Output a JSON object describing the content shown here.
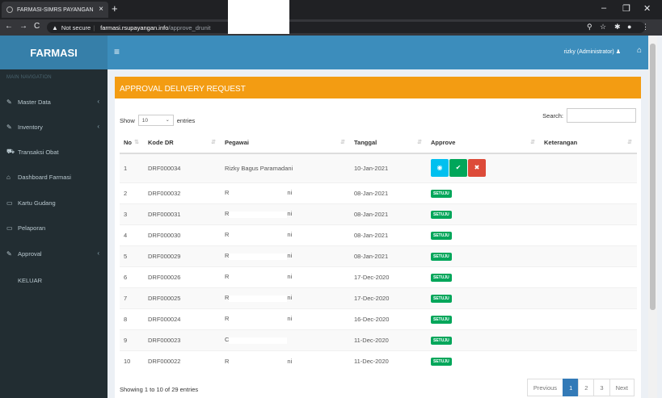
{
  "browser": {
    "tab_title": "FARMASI-SIMRS PAYANGAN",
    "tab_close": "×",
    "new_tab": "+",
    "min": "–",
    "restore": "❐",
    "close": "✕",
    "back": "←",
    "forward": "→",
    "reload": "C",
    "security": "Not secure",
    "host": "farmasi.rsupayangan.info",
    "path": "/approve_drunit"
  },
  "header": {
    "brand": "FARMASI",
    "menu_icon": "≡",
    "user": "rizky (Administrator)"
  },
  "sidebar": {
    "heading": "MAIN NAVIGATION",
    "items": [
      {
        "label": "Master Data",
        "icon": "edit-icon",
        "glyph": "✎",
        "chevron": "‹"
      },
      {
        "label": "Inventory",
        "icon": "edit-icon",
        "glyph": "✎",
        "chevron": "‹"
      },
      {
        "label": "Transaksi Obat",
        "icon": "car-icon",
        "glyph": "⛟",
        "chevron": ""
      },
      {
        "label": "Dashboard Farmasi",
        "icon": "home-icon",
        "glyph": "⌂",
        "chevron": ""
      },
      {
        "label": "Kartu Gudang",
        "icon": "folder-icon",
        "glyph": "▭",
        "chevron": ""
      },
      {
        "label": "Pelaporan",
        "icon": "folder-icon",
        "glyph": "▭",
        "chevron": ""
      },
      {
        "label": "Approval",
        "icon": "edit-icon",
        "glyph": "✎",
        "chevron": "‹"
      },
      {
        "label": "KELUAR",
        "icon": "",
        "glyph": "",
        "chevron": ""
      }
    ]
  },
  "box": {
    "title": "APPROVAL DELIVERY REQUEST",
    "show_label": "Show",
    "entries_value": "10",
    "entries_label": "entries",
    "search_label": "Search:",
    "columns": [
      "No",
      "Kode DR",
      "Pegawai",
      "Tanggal",
      "Approve",
      "Keterangan"
    ],
    "rows": [
      {
        "no": "1",
        "kode": "DRF000034",
        "pegawai": "Rizky Bagus Paramadani",
        "tanggal": "10-Jan-2021",
        "approve": "buttons"
      },
      {
        "no": "2",
        "kode": "DRF000032",
        "pegawai": "R",
        "pegawai_end": "ni",
        "tanggal": "08-Jan-2021",
        "approve": "SETUJU"
      },
      {
        "no": "3",
        "kode": "DRF000031",
        "pegawai": "R",
        "pegawai_end": "ni",
        "tanggal": "08-Jan-2021",
        "approve": "SETUJU"
      },
      {
        "no": "4",
        "kode": "DRF000030",
        "pegawai": "R",
        "pegawai_end": "ni",
        "tanggal": "08-Jan-2021",
        "approve": "SETUJU"
      },
      {
        "no": "5",
        "kode": "DRF000029",
        "pegawai": "R",
        "pegawai_end": "ni",
        "tanggal": "08-Jan-2021",
        "approve": "SETUJU"
      },
      {
        "no": "6",
        "kode": "DRF000026",
        "pegawai": "R",
        "pegawai_end": "ni",
        "tanggal": "17-Dec-2020",
        "approve": "SETUJU"
      },
      {
        "no": "7",
        "kode": "DRF000025",
        "pegawai": "R",
        "pegawai_end": "ni",
        "tanggal": "17-Dec-2020",
        "approve": "SETUJU"
      },
      {
        "no": "8",
        "kode": "DRF000024",
        "pegawai": "R",
        "pegawai_end": "ni",
        "tanggal": "16-Dec-2020",
        "approve": "SETUJU"
      },
      {
        "no": "9",
        "kode": "DRF000023",
        "pegawai": "C",
        "pegawai_end": "",
        "tanggal": "11-Dec-2020",
        "approve": "SETUJU"
      },
      {
        "no": "10",
        "kode": "DRF000022",
        "pegawai": "R",
        "pegawai_end": "ni",
        "tanggal": "11-Dec-2020",
        "approve": "SETUJU"
      }
    ],
    "info": "Showing 1 to 10 of 29 entries",
    "pagination": [
      "Previous",
      "1",
      "2",
      "3",
      "Next"
    ],
    "active_page": "1"
  },
  "colors": {
    "header": "#3c8dbc",
    "logo": "#367fa9",
    "sidebar": "#222d32",
    "box_accent": "#f39c12",
    "success": "#00a65a",
    "danger": "#dd4b39",
    "info": "#00c0ef"
  }
}
